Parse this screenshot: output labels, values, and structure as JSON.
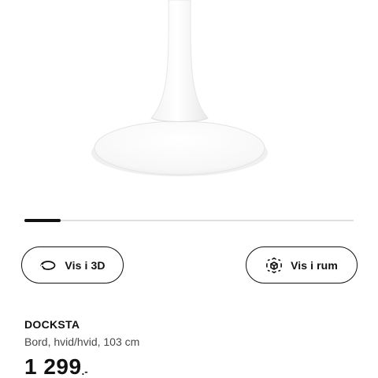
{
  "product": {
    "name": "DOCKSTA",
    "description": "Bord, hvid/hvid, 103 cm",
    "price_amount": "1 299",
    "price_suffix": ".-"
  },
  "gallery": {
    "current_image": 1,
    "progress": 0.11
  },
  "actions": {
    "view_3d_label": "Vis i 3D",
    "view_3d_icon": "rotate-3d-icon",
    "view_room_label": "Vis i rum",
    "view_room_icon": "augmented-reality-cube-icon"
  },
  "colors": {
    "text": "#111111",
    "muted": "#484848",
    "track": "#dfdfdf",
    "table": "#ffffff"
  }
}
